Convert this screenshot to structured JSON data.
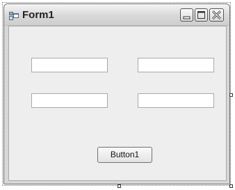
{
  "window": {
    "title": "Form1"
  },
  "title_buttons": {
    "minimize_icon": "minimize-icon",
    "maximize_icon": "maximize-icon",
    "close_icon": "close-icon"
  },
  "form": {
    "textboxes": [
      {
        "value": ""
      },
      {
        "value": ""
      },
      {
        "value": ""
      },
      {
        "value": ""
      }
    ],
    "button_label": "Button1"
  }
}
